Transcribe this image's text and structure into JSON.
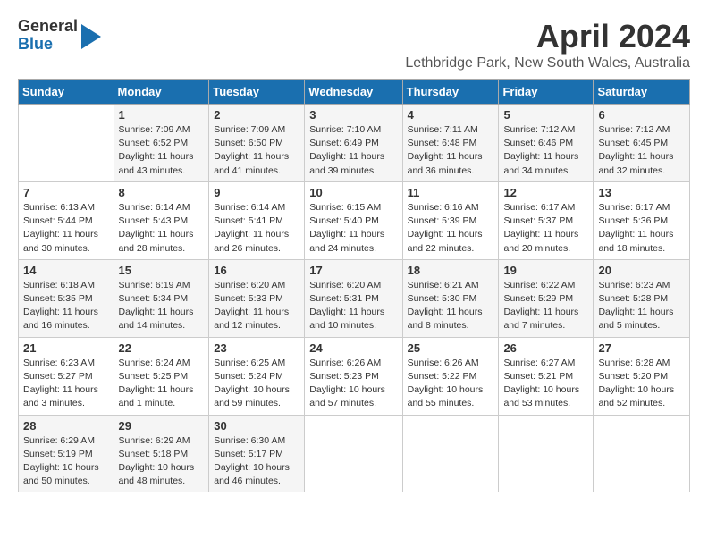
{
  "logo": {
    "line1": "General",
    "line2": "Blue"
  },
  "title": "April 2024",
  "location": "Lethbridge Park, New South Wales, Australia",
  "days_of_week": [
    "Sunday",
    "Monday",
    "Tuesday",
    "Wednesday",
    "Thursday",
    "Friday",
    "Saturday"
  ],
  "weeks": [
    [
      {
        "day": "",
        "sunrise": "",
        "sunset": "",
        "daylight": ""
      },
      {
        "day": "1",
        "sunrise": "Sunrise: 7:09 AM",
        "sunset": "Sunset: 6:52 PM",
        "daylight": "Daylight: 11 hours and 43 minutes."
      },
      {
        "day": "2",
        "sunrise": "Sunrise: 7:09 AM",
        "sunset": "Sunset: 6:50 PM",
        "daylight": "Daylight: 11 hours and 41 minutes."
      },
      {
        "day": "3",
        "sunrise": "Sunrise: 7:10 AM",
        "sunset": "Sunset: 6:49 PM",
        "daylight": "Daylight: 11 hours and 39 minutes."
      },
      {
        "day": "4",
        "sunrise": "Sunrise: 7:11 AM",
        "sunset": "Sunset: 6:48 PM",
        "daylight": "Daylight: 11 hours and 36 minutes."
      },
      {
        "day": "5",
        "sunrise": "Sunrise: 7:12 AM",
        "sunset": "Sunset: 6:46 PM",
        "daylight": "Daylight: 11 hours and 34 minutes."
      },
      {
        "day": "6",
        "sunrise": "Sunrise: 7:12 AM",
        "sunset": "Sunset: 6:45 PM",
        "daylight": "Daylight: 11 hours and 32 minutes."
      }
    ],
    [
      {
        "day": "7",
        "sunrise": "Sunrise: 6:13 AM",
        "sunset": "Sunset: 5:44 PM",
        "daylight": "Daylight: 11 hours and 30 minutes."
      },
      {
        "day": "8",
        "sunrise": "Sunrise: 6:14 AM",
        "sunset": "Sunset: 5:43 PM",
        "daylight": "Daylight: 11 hours and 28 minutes."
      },
      {
        "day": "9",
        "sunrise": "Sunrise: 6:14 AM",
        "sunset": "Sunset: 5:41 PM",
        "daylight": "Daylight: 11 hours and 26 minutes."
      },
      {
        "day": "10",
        "sunrise": "Sunrise: 6:15 AM",
        "sunset": "Sunset: 5:40 PM",
        "daylight": "Daylight: 11 hours and 24 minutes."
      },
      {
        "day": "11",
        "sunrise": "Sunrise: 6:16 AM",
        "sunset": "Sunset: 5:39 PM",
        "daylight": "Daylight: 11 hours and 22 minutes."
      },
      {
        "day": "12",
        "sunrise": "Sunrise: 6:17 AM",
        "sunset": "Sunset: 5:37 PM",
        "daylight": "Daylight: 11 hours and 20 minutes."
      },
      {
        "day": "13",
        "sunrise": "Sunrise: 6:17 AM",
        "sunset": "Sunset: 5:36 PM",
        "daylight": "Daylight: 11 hours and 18 minutes."
      }
    ],
    [
      {
        "day": "14",
        "sunrise": "Sunrise: 6:18 AM",
        "sunset": "Sunset: 5:35 PM",
        "daylight": "Daylight: 11 hours and 16 minutes."
      },
      {
        "day": "15",
        "sunrise": "Sunrise: 6:19 AM",
        "sunset": "Sunset: 5:34 PM",
        "daylight": "Daylight: 11 hours and 14 minutes."
      },
      {
        "day": "16",
        "sunrise": "Sunrise: 6:20 AM",
        "sunset": "Sunset: 5:33 PM",
        "daylight": "Daylight: 11 hours and 12 minutes."
      },
      {
        "day": "17",
        "sunrise": "Sunrise: 6:20 AM",
        "sunset": "Sunset: 5:31 PM",
        "daylight": "Daylight: 11 hours and 10 minutes."
      },
      {
        "day": "18",
        "sunrise": "Sunrise: 6:21 AM",
        "sunset": "Sunset: 5:30 PM",
        "daylight": "Daylight: 11 hours and 8 minutes."
      },
      {
        "day": "19",
        "sunrise": "Sunrise: 6:22 AM",
        "sunset": "Sunset: 5:29 PM",
        "daylight": "Daylight: 11 hours and 7 minutes."
      },
      {
        "day": "20",
        "sunrise": "Sunrise: 6:23 AM",
        "sunset": "Sunset: 5:28 PM",
        "daylight": "Daylight: 11 hours and 5 minutes."
      }
    ],
    [
      {
        "day": "21",
        "sunrise": "Sunrise: 6:23 AM",
        "sunset": "Sunset: 5:27 PM",
        "daylight": "Daylight: 11 hours and 3 minutes."
      },
      {
        "day": "22",
        "sunrise": "Sunrise: 6:24 AM",
        "sunset": "Sunset: 5:25 PM",
        "daylight": "Daylight: 11 hours and 1 minute."
      },
      {
        "day": "23",
        "sunrise": "Sunrise: 6:25 AM",
        "sunset": "Sunset: 5:24 PM",
        "daylight": "Daylight: 10 hours and 59 minutes."
      },
      {
        "day": "24",
        "sunrise": "Sunrise: 6:26 AM",
        "sunset": "Sunset: 5:23 PM",
        "daylight": "Daylight: 10 hours and 57 minutes."
      },
      {
        "day": "25",
        "sunrise": "Sunrise: 6:26 AM",
        "sunset": "Sunset: 5:22 PM",
        "daylight": "Daylight: 10 hours and 55 minutes."
      },
      {
        "day": "26",
        "sunrise": "Sunrise: 6:27 AM",
        "sunset": "Sunset: 5:21 PM",
        "daylight": "Daylight: 10 hours and 53 minutes."
      },
      {
        "day": "27",
        "sunrise": "Sunrise: 6:28 AM",
        "sunset": "Sunset: 5:20 PM",
        "daylight": "Daylight: 10 hours and 52 minutes."
      }
    ],
    [
      {
        "day": "28",
        "sunrise": "Sunrise: 6:29 AM",
        "sunset": "Sunset: 5:19 PM",
        "daylight": "Daylight: 10 hours and 50 minutes."
      },
      {
        "day": "29",
        "sunrise": "Sunrise: 6:29 AM",
        "sunset": "Sunset: 5:18 PM",
        "daylight": "Daylight: 10 hours and 48 minutes."
      },
      {
        "day": "30",
        "sunrise": "Sunrise: 6:30 AM",
        "sunset": "Sunset: 5:17 PM",
        "daylight": "Daylight: 10 hours and 46 minutes."
      },
      {
        "day": "",
        "sunrise": "",
        "sunset": "",
        "daylight": ""
      },
      {
        "day": "",
        "sunrise": "",
        "sunset": "",
        "daylight": ""
      },
      {
        "day": "",
        "sunrise": "",
        "sunset": "",
        "daylight": ""
      },
      {
        "day": "",
        "sunrise": "",
        "sunset": "",
        "daylight": ""
      }
    ]
  ]
}
